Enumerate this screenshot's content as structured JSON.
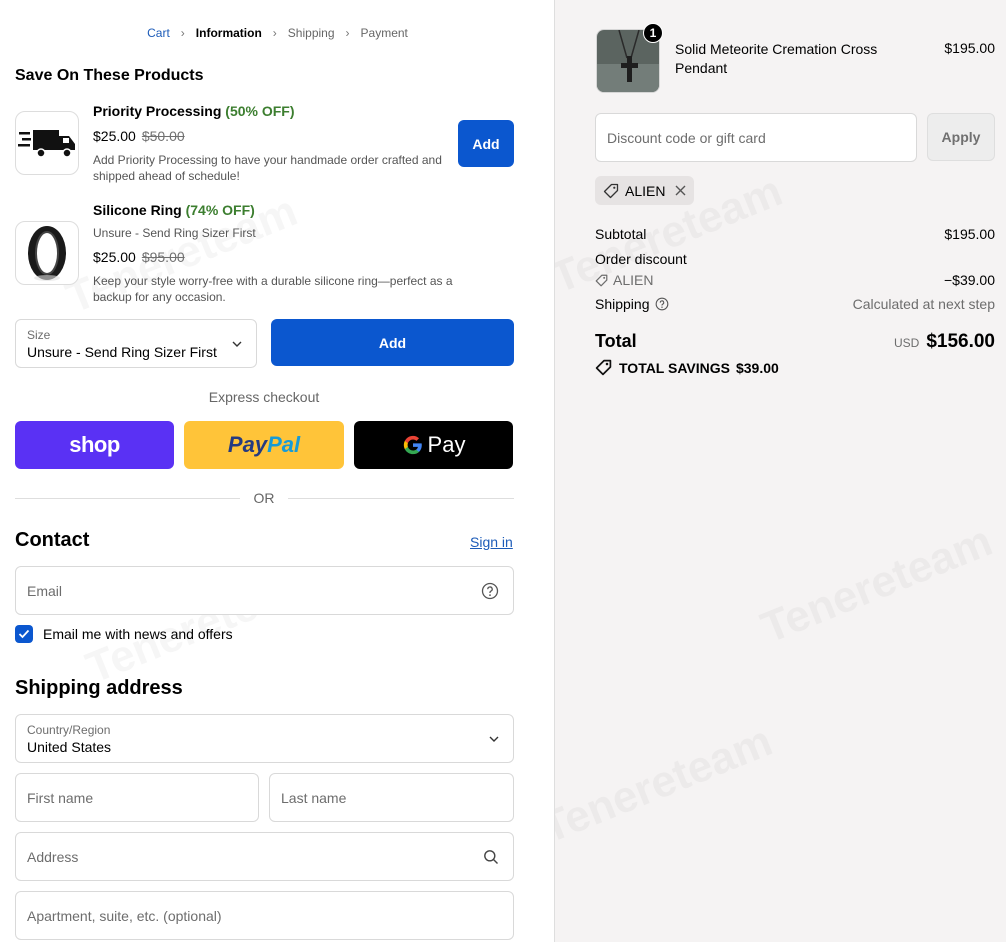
{
  "breadcrumb": {
    "cart": "Cart",
    "information": "Information",
    "shipping": "Shipping",
    "payment": "Payment"
  },
  "upsell": {
    "heading": "Save On These Products",
    "items": [
      {
        "name": "Priority Processing",
        "discount": "(50% OFF)",
        "price": "$25.00",
        "old_price": "$50.00",
        "variant": "",
        "description": "Add Priority Processing to have your handmade order crafted and shipped ahead of schedule!",
        "button": "Add",
        "icon": "delivery-truck-icon"
      },
      {
        "name": "Silicone Ring",
        "discount": "(74% OFF)",
        "variant": "Unsure - Send Ring Sizer First",
        "price": "$25.00",
        "old_price": "$95.00",
        "description": "Keep your style worry-free with a durable silicone ring—perfect as a backup for any occasion.",
        "icon": "silicone-ring-image"
      }
    ],
    "size_select": {
      "label": "Size",
      "value": "Unsure - Send Ring Sizer First"
    },
    "size_add_button": "Add"
  },
  "express": {
    "label": "Express checkout",
    "shop": "shop",
    "paypal_a": "Pay",
    "paypal_b": "Pal",
    "gpay": "Pay",
    "or": "OR"
  },
  "contact": {
    "heading": "Contact",
    "sign_in": "Sign in",
    "email_placeholder": "Email",
    "newsletter_label": "Email me with news and offers",
    "newsletter_checked": true
  },
  "shipping": {
    "heading": "Shipping address",
    "country_label": "Country/Region",
    "country_value": "United States",
    "first_name": "First name",
    "last_name": "Last name",
    "address": "Address",
    "apartment": "Apartment, suite, etc. (optional)"
  },
  "summary": {
    "product": {
      "name": "Solid Meteorite Cremation Cross Pendant",
      "price": "$195.00",
      "qty": "1"
    },
    "discount_placeholder": "Discount code or gift card",
    "apply": "Apply",
    "applied_code": "ALIEN",
    "subtotal_label": "Subtotal",
    "subtotal": "$195.00",
    "order_discount_label": "Order discount",
    "discount_code": "ALIEN",
    "discount_amount": "−$39.00",
    "shipping_label": "Shipping",
    "shipping_value": "Calculated at next step",
    "total_label": "Total",
    "currency": "USD",
    "total": "$156.00",
    "savings_label": "TOTAL SAVINGS",
    "savings": "$39.00"
  },
  "colors": {
    "accent": "#0b57cf",
    "shop_pay": "#5a31f4",
    "paypal": "#ffc439",
    "discount_green": "#3c7e2f"
  }
}
